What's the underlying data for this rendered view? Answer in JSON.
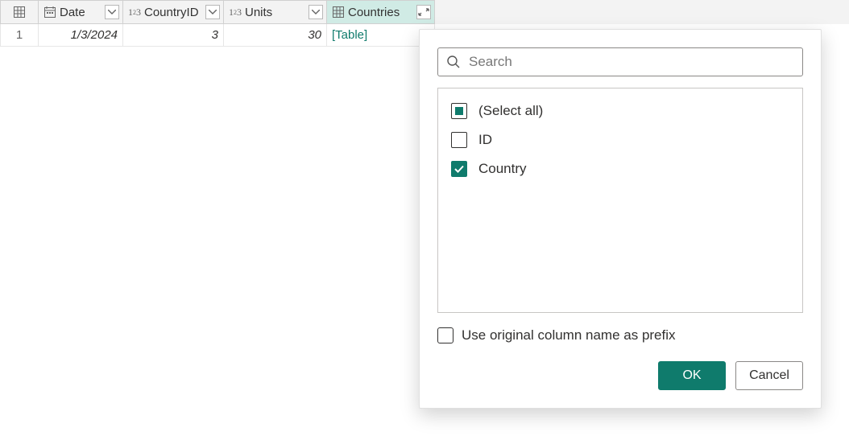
{
  "columns": {
    "date": "Date",
    "country_id": "CountryID",
    "units": "Units",
    "countries": "Countries"
  },
  "row": {
    "index": "1",
    "date": "1/3/2024",
    "country_id": "3",
    "units": "30",
    "countries": "[Table]"
  },
  "popup": {
    "search_placeholder": "Search",
    "select_all": "(Select all)",
    "opt_id": "ID",
    "opt_country": "Country",
    "prefix": "Use original column name as prefix",
    "ok": "OK",
    "cancel": "Cancel"
  }
}
